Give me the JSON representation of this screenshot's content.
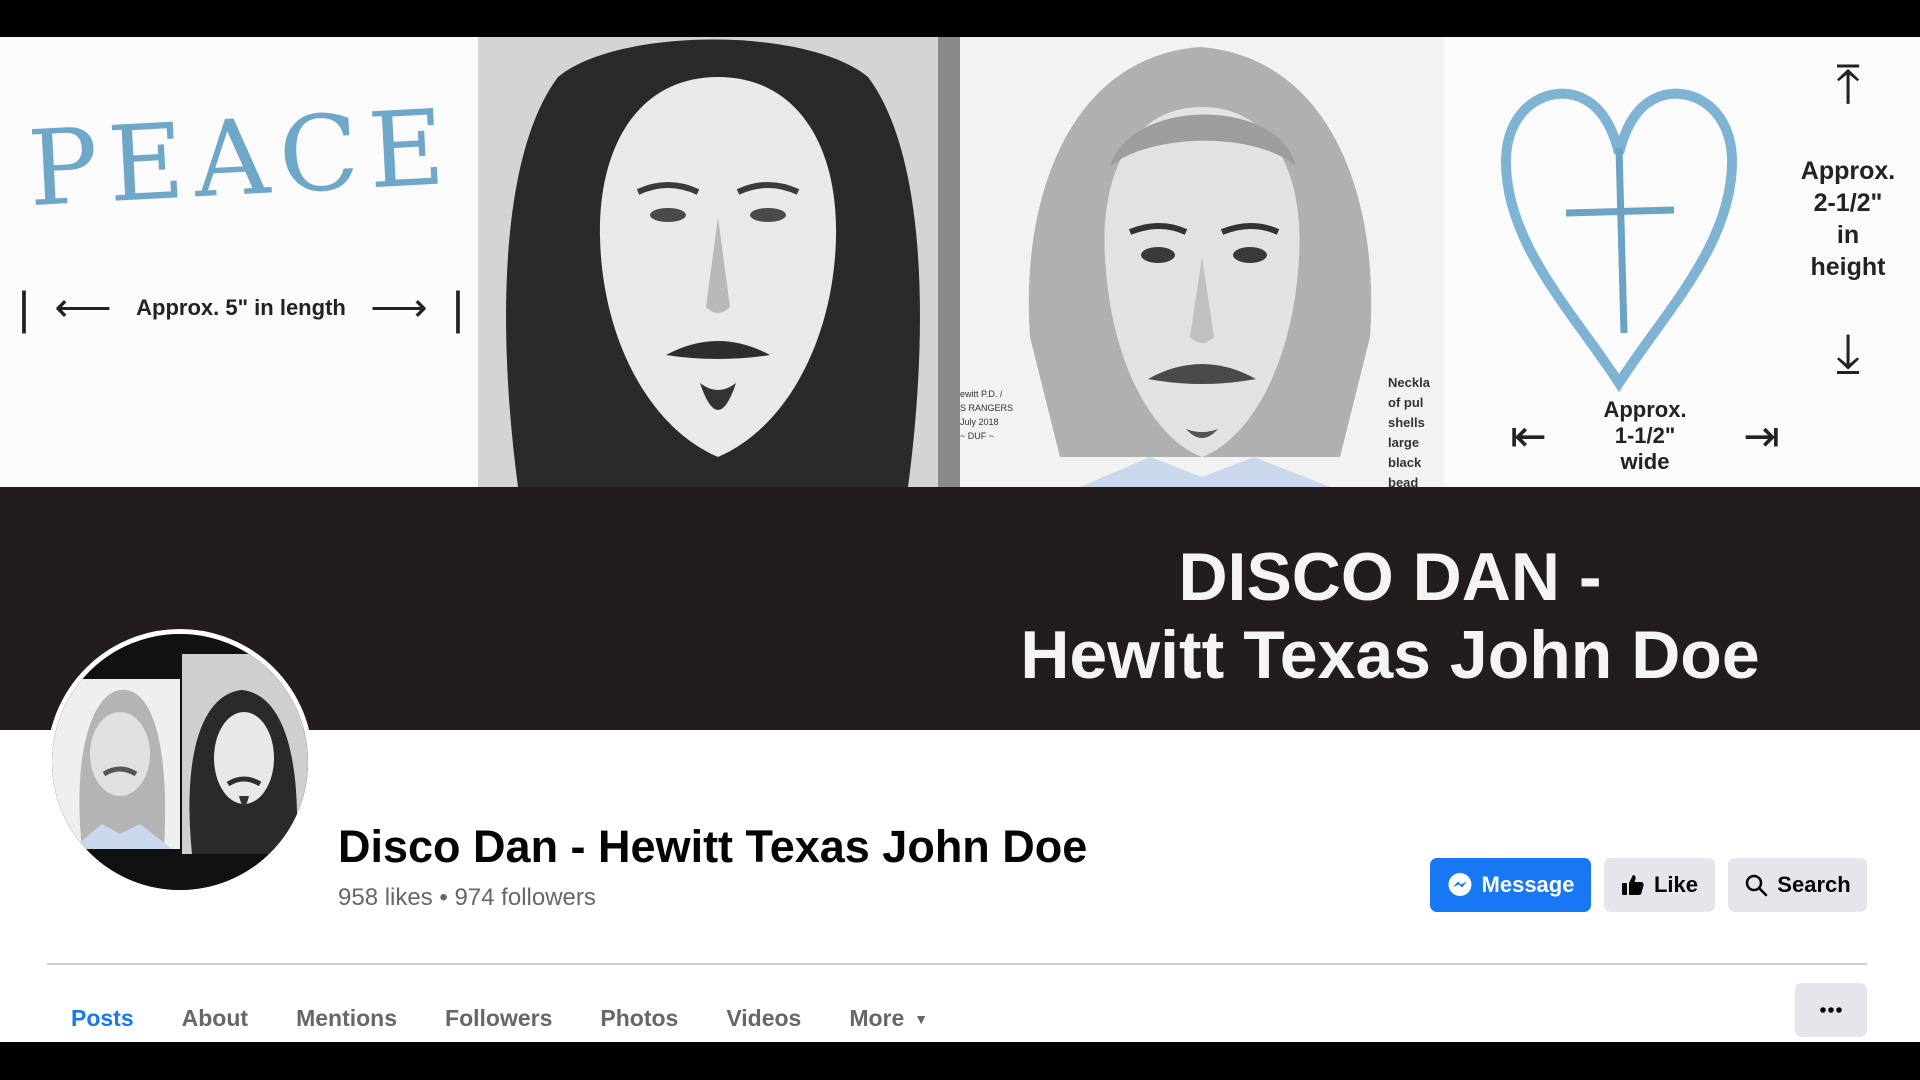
{
  "cover": {
    "peace_text": "PEACE",
    "length_note": "Approx. 5\" in length",
    "width_note_lines": [
      "Approx.",
      "1-1/2\"",
      "wide"
    ],
    "height_note_lines": [
      "Approx.",
      "2-1/2\"",
      "in",
      "height"
    ],
    "sketch_credit_lines": [
      "ewitt P.D. /",
      "S RANGERS",
      "",
      "July 2018",
      "~ DUF ~"
    ],
    "necklace_note_lines": [
      "Neckla",
      "of pul",
      "shells",
      "large",
      "black",
      "bead"
    ],
    "title_line1": "DISCO DAN -",
    "title_line2": "Hewitt Texas John Doe"
  },
  "profile": {
    "name": "Disco Dan - Hewitt Texas John Doe",
    "stats": "958 likes • 974 followers"
  },
  "actions": {
    "message": "Message",
    "like": "Like",
    "search": "Search"
  },
  "tabs": [
    {
      "label": "Posts"
    },
    {
      "label": "About"
    },
    {
      "label": "Mentions"
    },
    {
      "label": "Followers"
    },
    {
      "label": "Photos"
    },
    {
      "label": "Videos"
    },
    {
      "label": "More"
    }
  ],
  "colors": {
    "brand_blue": "#1877f2",
    "secondary_button": "#e4e6eb",
    "cover_band": "#221c1d"
  },
  "icons": {
    "message": "messenger-icon",
    "like": "thumbs-up-icon",
    "search": "search-icon",
    "more": "caret-down-icon",
    "overflow": "more-horizontal-icon"
  }
}
